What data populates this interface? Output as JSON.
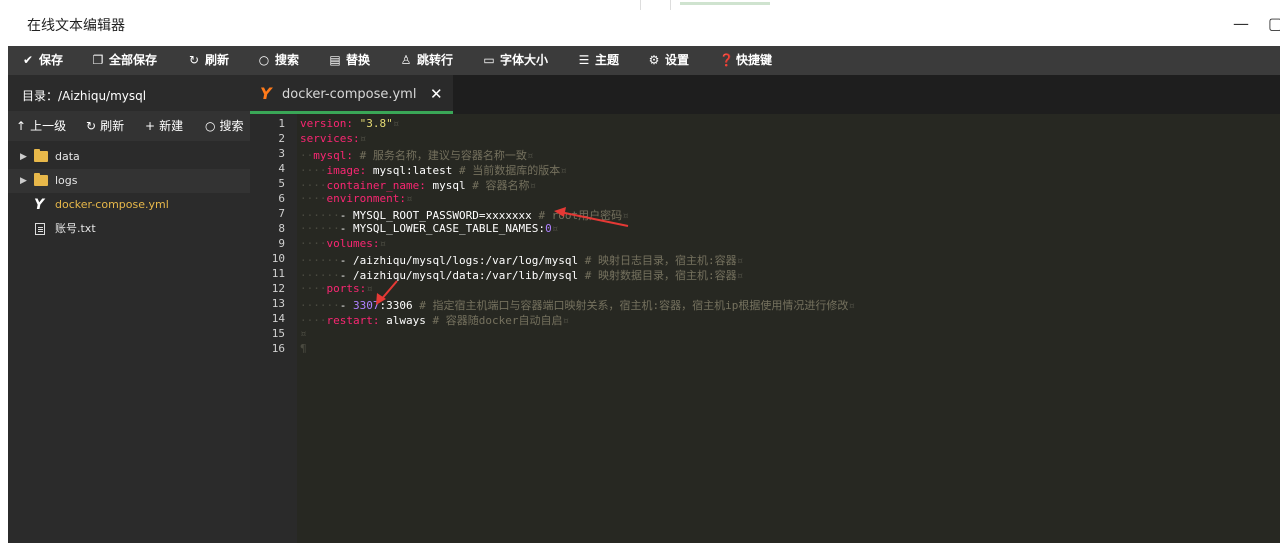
{
  "window": {
    "title": "在线文本编辑器"
  },
  "toolbar": {
    "items": [
      {
        "label": "保存",
        "icon": "check-icon"
      },
      {
        "label": "全部保存",
        "icon": "copy-icon"
      },
      {
        "label": "刷新",
        "icon": "refresh-icon"
      },
      {
        "label": "搜索",
        "icon": "search-icon"
      },
      {
        "label": "替换",
        "icon": "replace-icon"
      },
      {
        "label": "跳转行",
        "icon": "location-icon"
      },
      {
        "label": "字体大小",
        "icon": "font-size-icon"
      },
      {
        "label": "主题",
        "icon": "menu-icon"
      },
      {
        "label": "设置",
        "icon": "gear-icon"
      },
      {
        "label": "快捷键",
        "icon": "help-icon"
      }
    ]
  },
  "sidebar": {
    "path": "目录：/Aizhiqu/mysql",
    "actions": [
      {
        "label": "上一级",
        "icon": "arrow-up-icon"
      },
      {
        "label": "刷新",
        "icon": "refresh-icon"
      },
      {
        "label": "新建",
        "icon": "plus-icon"
      },
      {
        "label": "搜索",
        "icon": "search-icon"
      }
    ],
    "files": [
      {
        "name": "data",
        "type": "folder"
      },
      {
        "name": "logs",
        "type": "folder"
      },
      {
        "name": "docker-compose.yml",
        "type": "yaml"
      },
      {
        "name": "账号.txt",
        "type": "text"
      }
    ]
  },
  "tab": {
    "label": "docker-compose.yml"
  },
  "editor": {
    "line_numbers": [
      "1",
      "2",
      "3",
      "4",
      "5",
      "6",
      "7",
      "8",
      "9",
      "10",
      "11",
      "12",
      "13",
      "14",
      "15",
      "16"
    ],
    "code": {
      "l1_key": "version:",
      "l1_val": "\"3.8\"",
      "l2_key": "services:",
      "l3_key": "mysql:",
      "l3_comment": "# 服务名称，建议与容器名称一致",
      "l4_key": "image:",
      "l4_val": "mysql:latest",
      "l4_comment": "# 当前数据库的版本",
      "l5_key": "container_name:",
      "l5_val": "mysql",
      "l5_comment": "# 容器名称",
      "l6_key": "environment:",
      "l7_val": "- MYSQL_ROOT_PASSWORD=xxxxxxx",
      "l7_comment": "# root用户密码",
      "l8_val": "- MYSQL_LOWER_CASE_TABLE_NAMES:",
      "l8_num": "0",
      "l9_key": "volumes:",
      "l10_val": "- /aizhiqu/mysql/logs:/var/log/mysql",
      "l10_comment": "# 映射日志目录，宿主机:容器",
      "l11_val": "- /aizhiqu/mysql/data:/var/lib/mysql",
      "l11_comment": "# 映射数据目录，宿主机:容器",
      "l12_key": "ports:",
      "l13_dash": "-",
      "l13_num": "3307",
      "l13_val": ":3306",
      "l13_comment": "# 指定宿主机端口与容器端口映射关系，宿主机:容器，宿主机ip根据使用情况进行修改",
      "l14_key": "restart:",
      "l14_val": "always",
      "l14_comment": "# 容器随docker自动自启"
    }
  },
  "colors": {
    "accent": "#3aa757",
    "folder": "#e8b84a",
    "active_file": "#e8b84a",
    "annotation": "#e53935"
  }
}
